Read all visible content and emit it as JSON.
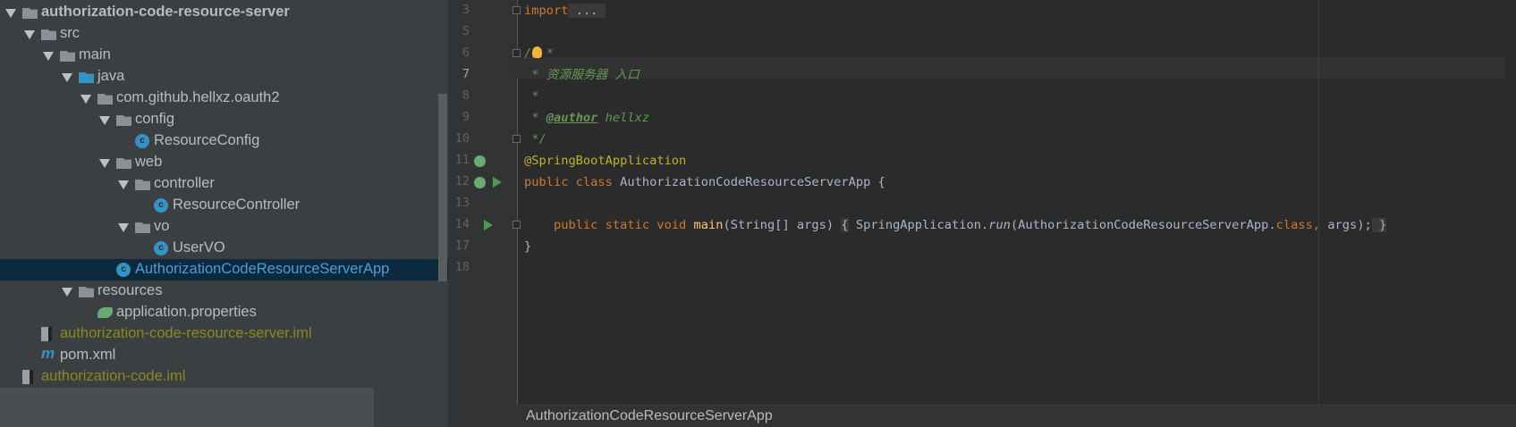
{
  "project_tree": [
    {
      "label": "authorization-code-resource-server",
      "level": 0,
      "expanded": true,
      "icon": "module-folder-icon",
      "style": "bold"
    },
    {
      "label": "src",
      "level": 1,
      "expanded": true,
      "icon": "folder-icon"
    },
    {
      "label": "main",
      "level": 2,
      "expanded": true,
      "icon": "folder-icon"
    },
    {
      "label": "java",
      "level": 3,
      "expanded": true,
      "icon": "source-folder-icon"
    },
    {
      "label": "com.github.hellxz.oauth2",
      "level": 4,
      "expanded": true,
      "icon": "package-icon"
    },
    {
      "label": "config",
      "level": 5,
      "expanded": true,
      "icon": "package-icon"
    },
    {
      "label": "ResourceConfig",
      "level": 6,
      "icon": "class-icon"
    },
    {
      "label": "web",
      "level": 5,
      "expanded": true,
      "icon": "package-icon"
    },
    {
      "label": "controller",
      "level": 6,
      "expanded": true,
      "icon": "package-icon"
    },
    {
      "label": "ResourceController",
      "level": 7,
      "icon": "class-icon"
    },
    {
      "label": "vo",
      "level": 6,
      "expanded": true,
      "icon": "package-icon"
    },
    {
      "label": "UserVO",
      "level": 7,
      "icon": "class-icon"
    },
    {
      "label": "AuthorizationCodeResourceServerApp",
      "level": 5,
      "icon": "spring-boot-class-icon",
      "style": "sel"
    },
    {
      "label": "resources",
      "level": 3,
      "expanded": true,
      "icon": "resources-folder-icon"
    },
    {
      "label": "application.properties",
      "level": 4,
      "icon": "spring-properties-icon"
    },
    {
      "label": "authorization-code-resource-server.iml",
      "level": 1,
      "icon": "iml-file-icon",
      "style": "olive"
    },
    {
      "label": "pom.xml",
      "level": 1,
      "icon": "maven-icon"
    },
    {
      "label": "authorization-code.iml",
      "level": 0,
      "icon": "iml-file-icon",
      "style": "olive"
    }
  ],
  "editor": {
    "current_line": "7",
    "lines": [
      {
        "n": "3",
        "fold": "plus",
        "tokens": [
          [
            "kw",
            "import"
          ],
          [
            "",
            ""
          ],
          [
            "fold",
            " ... "
          ]
        ]
      },
      {
        "n": "5",
        "tokens": []
      },
      {
        "n": "6",
        "fold": "minus",
        "bulb": true,
        "tokens": [
          [
            "cm",
            "/  *"
          ]
        ]
      },
      {
        "n": "7",
        "tokens": [
          [
            "cm",
            " * 资源服务器 入口"
          ]
        ]
      },
      {
        "n": "8",
        "tokens": [
          [
            "cm",
            " *"
          ]
        ]
      },
      {
        "n": "9",
        "tokens": [
          [
            "cm",
            " * "
          ],
          [
            "tag",
            "@author"
          ],
          [
            "cm",
            " hellxz"
          ]
        ]
      },
      {
        "n": "10",
        "fold": "end",
        "tokens": [
          [
            "cm",
            " */"
          ]
        ]
      },
      {
        "n": "11",
        "gutter": "spring",
        "tokens": [
          [
            "an",
            "@SpringBootApplication"
          ]
        ]
      },
      {
        "n": "12",
        "gutter": "spring-run",
        "tokens": [
          [
            "kw",
            "public class "
          ],
          [
            "",
            "AuthorizationCodeResourceServerApp {"
          ]
        ]
      },
      {
        "n": "13",
        "tokens": []
      },
      {
        "n": "14",
        "gutter": "run",
        "fold": "plus",
        "tokens": [
          [
            "",
            "    "
          ],
          [
            "kw",
            "public static void "
          ],
          [
            "fn",
            "main"
          ],
          [
            "",
            "(String[] args) "
          ],
          [
            "fold",
            "{"
          ],
          [
            "",
            " SpringApplication."
          ],
          [
            "it",
            "run"
          ],
          [
            "",
            "(AuthorizationCodeResourceServerApp."
          ],
          [
            "kw",
            "class, "
          ],
          [
            "",
            "args);"
          ],
          [
            "fold",
            " }"
          ]
        ]
      },
      {
        "n": "17",
        "tokens": [
          [
            "",
            "}"
          ]
        ]
      },
      {
        "n": "18",
        "tokens": []
      }
    ]
  },
  "breadcrumb": "AuthorizationCodeResourceServerApp"
}
